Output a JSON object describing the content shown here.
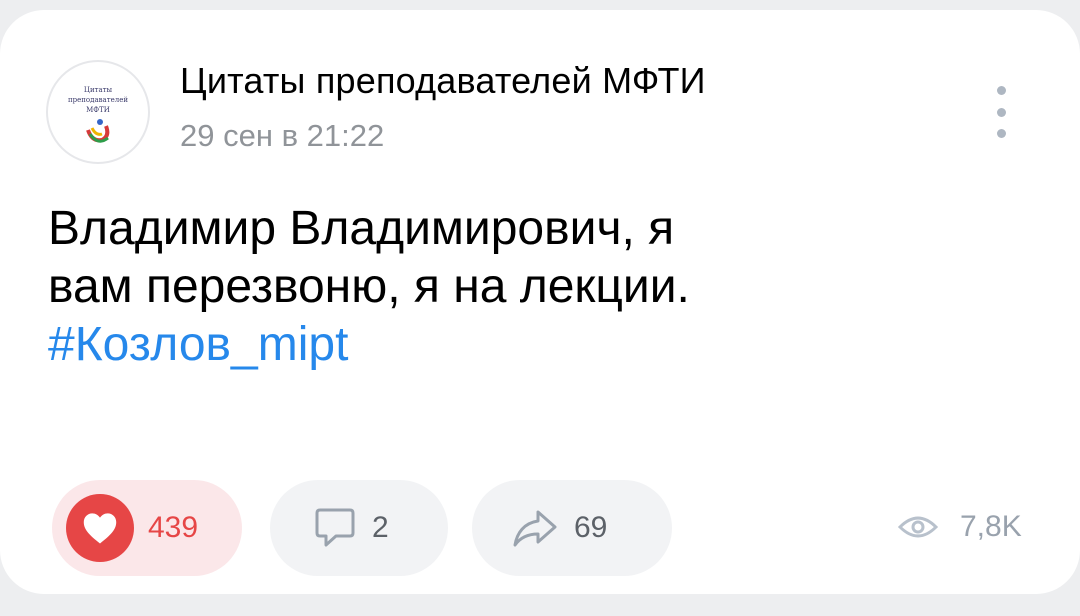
{
  "post": {
    "group_name": "Цитаты преподавателей МФТИ",
    "date": "29 сен в 21:22",
    "avatar": {
      "line1": "Цитаты",
      "line2": "преподавателей",
      "line3": "МФТИ"
    },
    "text_lines": [
      "Владимир Владимирович, я",
      "вам перезвоню, я на лекции."
    ],
    "hashtag": "#Козлов_mipt"
  },
  "actions": {
    "likes": "439",
    "comments": "2",
    "shares": "69",
    "views": "7,8K"
  },
  "icons": [
    "more-vertical-icon",
    "heart-icon",
    "comment-icon",
    "share-icon",
    "eye-icon"
  ],
  "colors": {
    "like_red": "#e64646",
    "like_bg": "#fbe7e9",
    "hashtag_blue": "#2688eb",
    "secondary_text": "#909499",
    "button_bg": "#f2f3f5"
  }
}
